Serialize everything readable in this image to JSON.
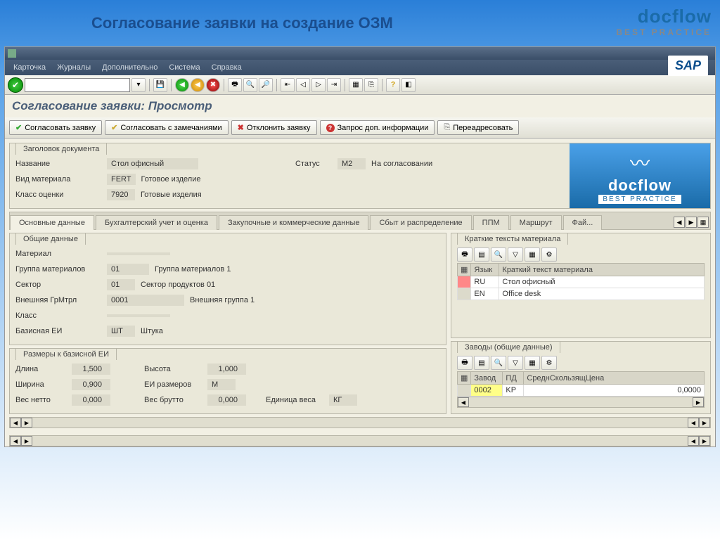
{
  "slide": {
    "title": "Согласование заявки на создание ОЗМ"
  },
  "logo": {
    "main": "docflow",
    "sub": "BEST  PRACTICE"
  },
  "menu": [
    "Карточка",
    "Журналы",
    "Дополнительно",
    "Система",
    "Справка"
  ],
  "page_title": "Согласование заявки: Просмотр",
  "actions": {
    "approve": "Согласовать заявку",
    "approve_notes": "Согласовать с замечаниями",
    "reject": "Отклонить заявку",
    "request_info": "Запрос доп. информации",
    "forward": "Переадресовать"
  },
  "header": {
    "group_title": "Заголовок документа",
    "name_label": "Название",
    "name_val": "Стол офисный",
    "status_label": "Статус",
    "status_code": "M2",
    "status_text": "На согласовании",
    "mattype_label": "Вид материала",
    "mattype_code": "FERT",
    "mattype_text": "Готовое изделие",
    "valclass_label": "Класс оценки",
    "valclass_code": "7920",
    "valclass_text": "Готовые изделия"
  },
  "tabs": [
    "Основные данные",
    "Бухгалтерский учет и оценка",
    "Закупочные и коммерческие данные",
    "Сбыт и распределение",
    "ППМ",
    "Маршрут",
    "Фай..."
  ],
  "general": {
    "group_title": "Общие данные",
    "material_label": "Материал",
    "material_val": "",
    "matgroup_label": "Группа материалов",
    "matgroup_code": "01",
    "matgroup_text": "Группа материалов 1",
    "sector_label": "Сектор",
    "sector_code": "01",
    "sector_text": "Сектор продуктов 01",
    "extgroup_label": "Внешняя ГрМтрл",
    "extgroup_code": "0001",
    "extgroup_text": "Внешняя группа 1",
    "class_label": "Класс",
    "class_val": "",
    "baseunit_label": "Базисная ЕИ",
    "baseunit_code": "ШТ",
    "baseunit_text": "Штука"
  },
  "dimensions": {
    "group_title": "Размеры к базисной ЕИ",
    "length_label": "Длина",
    "length_val": "1,500",
    "height_label": "Высота",
    "height_val": "1,000",
    "width_label": "Ширина",
    "width_val": "0,900",
    "dimunit_label": "ЕИ размеров",
    "dimunit_val": "M",
    "net_label": "Вес нетто",
    "net_val": "0,000",
    "gross_label": "Вес брутто",
    "gross_val": "0,000",
    "weightunit_label": "Единица веса",
    "weightunit_val": "КГ"
  },
  "shorttext": {
    "group_title": "Краткие тексты материала",
    "col_lang": "Язык",
    "col_text": "Краткий текст материала",
    "rows": [
      {
        "lang": "RU",
        "text": "Стол офисный"
      },
      {
        "lang": "EN",
        "text": "Office desk"
      }
    ]
  },
  "plants": {
    "group_title": "Заводы (общие данные)",
    "col_plant": "Завод",
    "col_pd": "ПД",
    "col_price": "СреднСкользящЦена",
    "rows": [
      {
        "plant": "0002",
        "pd": "KP",
        "price": "0,0000"
      }
    ]
  }
}
